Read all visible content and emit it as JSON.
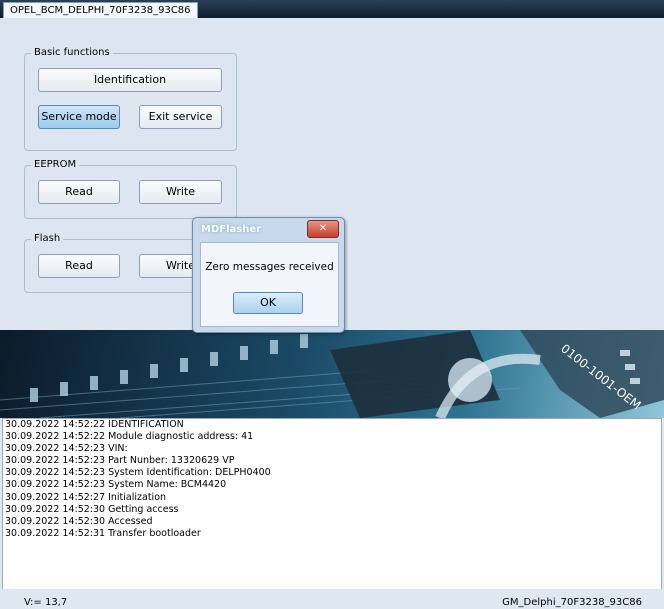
{
  "tab": {
    "label": "OPEL_BCM_DELPHI_70F3238_93C86"
  },
  "basic": {
    "legend": "Basic functions",
    "identification": "Identification",
    "service_mode": "Service mode",
    "exit_service": "Exit service"
  },
  "eeprom": {
    "legend": "EEPROM",
    "read": "Read",
    "write": "Write"
  },
  "flash": {
    "legend": "Flash",
    "read": "Read",
    "write": "Write"
  },
  "dialog": {
    "title": "MDFlasher",
    "close": "✕",
    "message": "Zero messages received",
    "ok": "OK"
  },
  "banner": {
    "chip_text": "0100-1001-OEM"
  },
  "log": {
    "lines": [
      "30.09.2022 14:52:22  IDENTIFICATION",
      "30.09.2022 14:52:22  Module diagnostic address: 41",
      "30.09.2022 14:52:23  VIN:",
      "30.09.2022 14:52:23  Part Nunber: 13320629  VP",
      "30.09.2022 14:52:23  System Identification: DELPH0400",
      "30.09.2022 14:52:23  System Name: BCM4420",
      "30.09.2022 14:52:27  Initialization",
      "30.09.2022 14:52:30  Getting access",
      "30.09.2022 14:52:30  Accessed",
      "30.09.2022 14:52:31  Transfer bootloader"
    ]
  },
  "status": {
    "voltage": "V:= 13,7",
    "module": "GM_Delphi_70F3238_93C86"
  },
  "colors": {
    "accent": "#9ccbed",
    "close_button": "#c5402b",
    "banner_dark": "#0c1b2a"
  }
}
